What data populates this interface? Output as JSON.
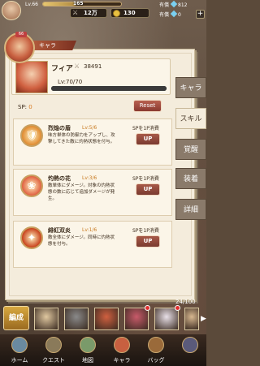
{
  "topbar": {
    "level": "Lv.66",
    "exp_value": "165",
    "exp_max": "400",
    "stamina": "12万",
    "gold": "130",
    "paid_label": "有償",
    "paid_value": "812",
    "free_label": "有償",
    "free_value": "0"
  },
  "character": {
    "badge_level": "66",
    "ribbon_name": "キャラ",
    "name": "フィア",
    "power": "38491",
    "level": "Lv:70/70",
    "level_fraction": 1.0
  },
  "tabs": [
    {
      "label": "キャラ",
      "active": false
    },
    {
      "label": "スキル",
      "active": true
    },
    {
      "label": "覚醒",
      "active": false
    },
    {
      "label": "装着",
      "active": false
    },
    {
      "label": "詳細",
      "active": false
    }
  ],
  "sp": {
    "label": "SP:",
    "value": "0"
  },
  "reset_label": "Reset",
  "skills": [
    {
      "name": "烈焔の盾",
      "level": "Lv:5/6",
      "desc": "味方単体の防御力をアップし、攻撃してきた敵に灼熱状態を付与。",
      "cost": "SPを1P消費",
      "up": "UP",
      "color": "#e08a30"
    },
    {
      "name": "灼熱の花",
      "level": "Lv:3/6",
      "desc": "敵単体にダメージ。対象の灼熱状態の数に応じて追加ダメージが発生。",
      "cost": "SPを1P消費",
      "up": "UP",
      "color": "#e06040"
    },
    {
      "name": "緋紅双炎",
      "level": "Lv:1/6",
      "desc": "敵全体にダメージ。同時に灼熱状態を付与。",
      "cost": "SPを1P消費",
      "up": "UP",
      "color": "#c8401a"
    }
  ],
  "roster": {
    "count": "24/100",
    "formation": "編成",
    "arrow": "▶",
    "thumbs": [
      {
        "color": "#e0c8a0"
      },
      {
        "color": "#8a8a8a"
      },
      {
        "color": "#d06040"
      },
      {
        "color": "#c85a6a"
      },
      {
        "color": "#e8e0e8"
      },
      {
        "color": "#d8b890"
      }
    ]
  },
  "nav": [
    {
      "label": "ホーム",
      "icon": "home-icon"
    },
    {
      "label": "クエスト",
      "icon": "quest-icon"
    },
    {
      "label": "地図",
      "icon": "map-icon"
    },
    {
      "label": "キャラ",
      "icon": "character-icon"
    },
    {
      "label": "バッグ",
      "icon": "bag-icon"
    },
    {
      "label": "",
      "icon": "more-icon"
    }
  ]
}
